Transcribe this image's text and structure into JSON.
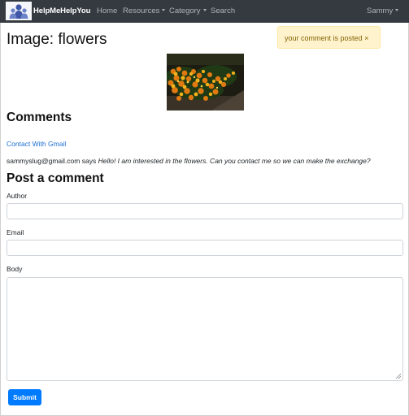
{
  "navbar": {
    "brand": "HelpMeHelpYou",
    "items": [
      {
        "label": "Home"
      },
      {
        "label": "Resources"
      },
      {
        "label": "Category"
      },
      {
        "label": "Search"
      }
    ],
    "user": "Sammy"
  },
  "alert": {
    "message": "your comment is posted",
    "close": "×"
  },
  "page": {
    "title": "Image: flowers"
  },
  "comments": {
    "heading": "Comments",
    "contact_link": "Contact With Gmail",
    "items": [
      {
        "author": "sammyslug@gmail.com",
        "verb": "says",
        "body": "Hello! I am interested in the flowers. Can you contact me so we can make the exchange?"
      }
    ]
  },
  "form": {
    "heading": "Post a comment",
    "author_label": "Author",
    "author_value": "",
    "email_label": "Email",
    "email_value": "",
    "body_label": "Body",
    "body_value": "",
    "submit_label": "Submit"
  },
  "colors": {
    "navbar_bg": "#343a40",
    "link": "#1a6fd6",
    "primary": "#007bff",
    "alert_bg": "#fff3cd",
    "alert_text": "#856404"
  },
  "icons": {
    "logo": "handshake-logo-icon",
    "resize": "resize-grip-icon"
  }
}
